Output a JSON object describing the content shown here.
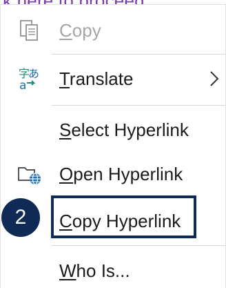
{
  "top_text": {
    "prefix": "...",
    "link": "k here",
    "rest": " to proceed"
  },
  "menu": {
    "items": [
      {
        "label_accel": "C",
        "label_rest": "opy",
        "icon": "copy-icon",
        "disabled": true
      },
      {
        "label_accel": "T",
        "label_rest": "ranslate",
        "icon": "translate-icon",
        "has_submenu": true
      },
      {
        "label_accel": "S",
        "label_rest": "elect Hyperlink"
      },
      {
        "label_accel": "O",
        "label_rest": "pen Hyperlink",
        "icon": "open-hyperlink-icon"
      },
      {
        "label_accel": "C",
        "label_rest": "opy Hyperlink",
        "highlighted": true
      },
      {
        "label_accel": "W",
        "label_rest": "ho Is..."
      }
    ]
  },
  "annotation": {
    "step_number": "2",
    "color": "#0e2a55"
  }
}
